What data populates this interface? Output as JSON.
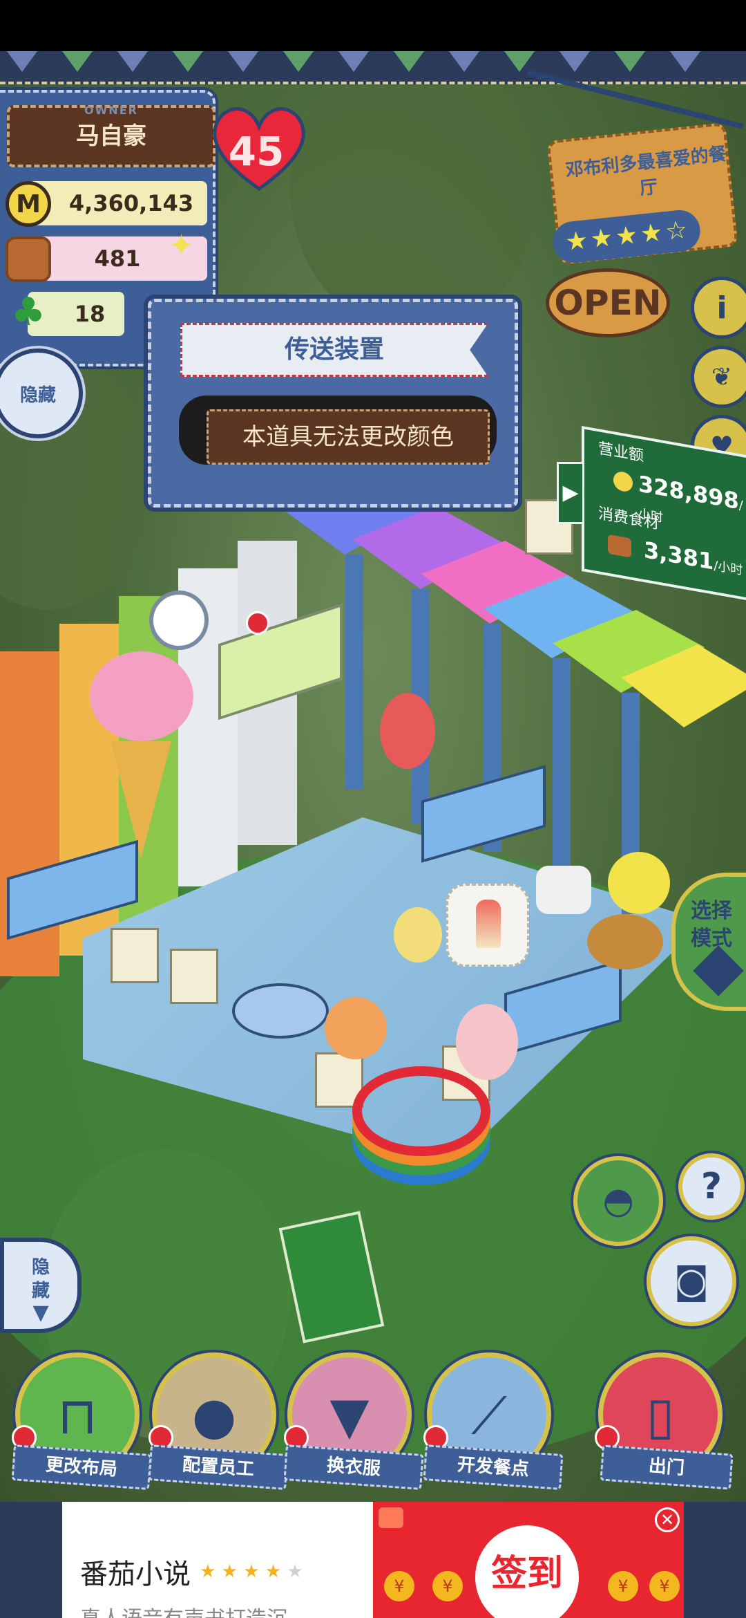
{
  "owner": {
    "tag_caption": "OWNER",
    "name": "马自豪",
    "coins": "4,360,143",
    "coin_symbol": "M",
    "food": "481",
    "clover": "18",
    "hearts": "45"
  },
  "left_buttons": {
    "hide_label": "隐藏",
    "hide_down_label": "隐\n藏"
  },
  "tooltip": {
    "title": "传送装置",
    "message": "本道具无法更改颜色"
  },
  "restaurant_sign": {
    "name": "邓布利多最喜爱的餐厅",
    "rating": 4,
    "max_rating": 5,
    "status": "OPEN"
  },
  "right_buttons": {
    "info_icon": "info-icon",
    "book_icon": "book-icon",
    "heart_icon": "heart-bubble-icon"
  },
  "revenue_board": {
    "revenue_label": "营业额",
    "revenue_value": "328,898",
    "revenue_unit": "/小时",
    "food_label": "消费食材",
    "food_value": "3,381",
    "food_unit": "/小时"
  },
  "mode_button": {
    "label_line1": "选择",
    "label_line2": "模式"
  },
  "action_buttons": {
    "hat_icon": "hat-icon",
    "help_label": "?",
    "camera_icon": "camera-icon"
  },
  "toolbar": [
    {
      "label": "更改布局",
      "icon": "table-icon",
      "color": "#5fb64e"
    },
    {
      "label": "配置员工",
      "icon": "bear-head-icon",
      "color": "#c8b48a"
    },
    {
      "label": "换衣服",
      "icon": "shirt-icon",
      "color": "#d98fb0"
    },
    {
      "label": "开发餐点",
      "icon": "knife-icon",
      "color": "#8ab6dd"
    },
    {
      "label": "出门",
      "icon": "door-icon",
      "color": "#e0465a"
    }
  ],
  "ad": {
    "title": "番茄小说",
    "rating": 4,
    "subtitle": "真人语音有声书打造沉...",
    "cta": "签到",
    "close_glyph": "✕",
    "coin_glyph": "¥"
  }
}
